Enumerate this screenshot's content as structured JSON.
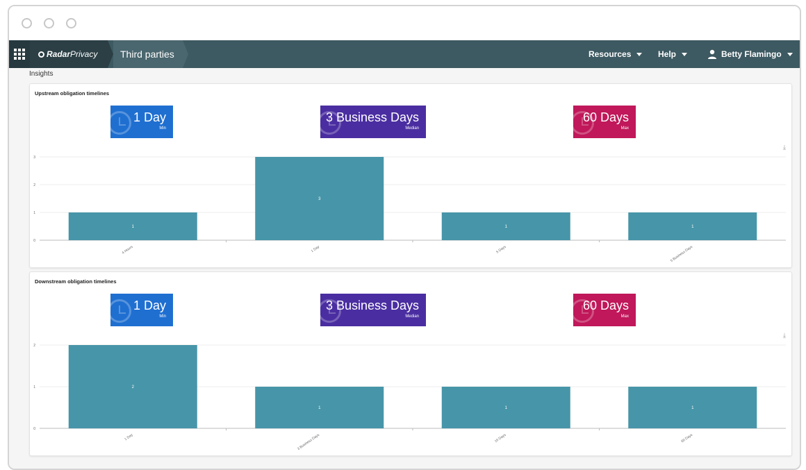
{
  "header": {
    "brand_bold": "Radar",
    "brand_light": "Privacy",
    "breadcrumb": "Third parties",
    "nav": [
      {
        "label": "Resources"
      },
      {
        "label": "Help"
      }
    ],
    "user_name": "Betty Flamingo"
  },
  "page": {
    "section_title": "Insights"
  },
  "colors": {
    "min": "#1f6fd1",
    "median": "#4a2ea1",
    "max": "#c0185a",
    "bar": "#4795a8"
  },
  "icons": [
    "apps-grid-icon",
    "radar-logo-icon",
    "chevron-down-icon",
    "user-icon",
    "clock-icon",
    "download-icon"
  ],
  "cards": [
    {
      "title": "Upstream obligation timelines",
      "stats": [
        {
          "value": "1 Day",
          "label": "Min"
        },
        {
          "value": "3 Business Days",
          "label": "Median"
        },
        {
          "value": "60 Days",
          "label": "Max"
        }
      ]
    },
    {
      "title": "Downstream obligation timelines",
      "stats": [
        {
          "value": "1 Day",
          "label": "Min"
        },
        {
          "value": "3 Business Days",
          "label": "Median"
        },
        {
          "value": "60 Days",
          "label": "Max"
        }
      ]
    }
  ],
  "chart_data": [
    {
      "type": "bar",
      "title": "Upstream obligation timelines",
      "categories": [
        "4 Hours",
        "1 Day",
        "5 Days",
        "5 Business Days"
      ],
      "values": [
        1,
        3,
        1,
        1
      ],
      "yticks": [
        0,
        1,
        2,
        3
      ],
      "ylim": [
        0,
        3
      ],
      "grid": true
    },
    {
      "type": "bar",
      "title": "Downstream obligation timelines",
      "categories": [
        "1 Day",
        "3 Business Days",
        "10 Days",
        "60 Days"
      ],
      "values": [
        2,
        1,
        1,
        1
      ],
      "yticks": [
        0,
        1,
        2
      ],
      "ylim": [
        0,
        2
      ],
      "grid": true
    }
  ]
}
